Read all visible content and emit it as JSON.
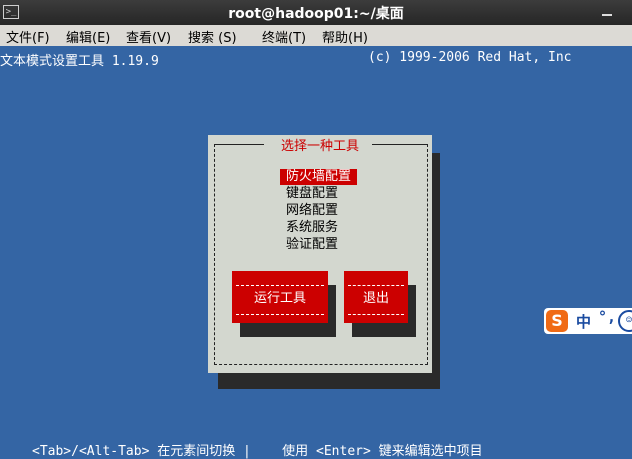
{
  "window": {
    "title": "root@hadoop01:~/桌面",
    "icon": "terminal-icon"
  },
  "menu": [
    "文件(F)",
    "编辑(E)",
    "查看(V)",
    "搜索 (S)",
    "终端(T)",
    "帮助(H)"
  ],
  "header": {
    "left": "文本模式设置工具 1.19.9",
    "right": "(c) 1999-2006 Red Hat, Inc"
  },
  "dialog": {
    "title": "选择一种工具",
    "items": [
      "防火墙配置",
      "键盘配置",
      "网络配置",
      "系统服务",
      "验证配置"
    ],
    "selected_index": 0,
    "run_button": "运行工具",
    "quit_button": "退出"
  },
  "footer": "<Tab>/<Alt-Tab> 在元素间切换 |    使用 <Enter> 键来编辑选中项目",
  "ime": {
    "icon": "sogou-logo-icon",
    "logo": "S",
    "mode": "中",
    "punct": "°,",
    "emoji_icon": "smiley-icon"
  },
  "colors": {
    "terminal_bg": "#3465a4",
    "dialog_bg": "#d3d7cf",
    "accent": "#cc0000"
  }
}
